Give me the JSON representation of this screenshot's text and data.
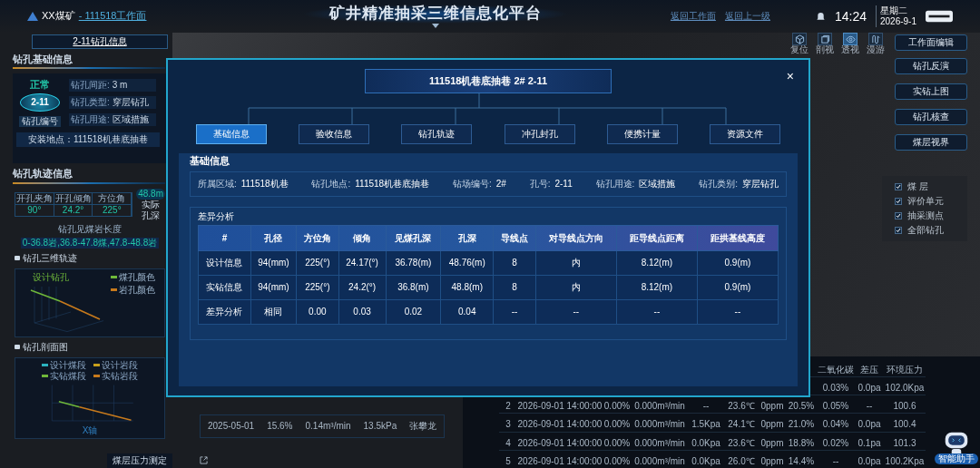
{
  "header": {
    "mine": "XX煤矿",
    "workface": "- 111518工作面",
    "title": "矿井精准抽采三维信息化平台",
    "nav": [
      "返回工作面",
      "返回上一级"
    ],
    "time": "14:24",
    "weekday": "星期二",
    "date": "2026-9-1"
  },
  "toolbar": [
    {
      "label": "复位",
      "selected": false
    },
    {
      "label": "剖视",
      "selected": false
    },
    {
      "label": "透视",
      "selected": true
    },
    {
      "label": "漫游",
      "selected": false
    }
  ],
  "left": {
    "tab": "2-11钻孔信息",
    "basic_title": "钻孔基础信息",
    "status": "正常",
    "hole_no": "2-11",
    "hole_no_label": "钻孔编号",
    "fields": [
      {
        "label": "钻孔间距:",
        "value": "3 m"
      },
      {
        "label": "钻孔类型:",
        "value": "穿层钻孔"
      },
      {
        "label": "钻孔用途:",
        "value": "区域措施"
      }
    ],
    "location": "安装地点：111518机巷底抽巷",
    "track_title": "钻孔轨迹信息",
    "angles": [
      {
        "label": "开孔夹角",
        "value": "90°"
      },
      {
        "label": "开孔倾角",
        "value": "24.2°"
      },
      {
        "label": "方位角",
        "value": "225°"
      }
    ],
    "depth": "48.8m",
    "depth_label": "实际孔深",
    "seam_label": "钻孔见煤岩长度",
    "seam_value": "0-36.8岩,36.8-47.8煤,47.8-48.8岩",
    "chart3d_title": "钻孔三维轨迹",
    "chart3d_legend": [
      {
        "label": "煤孔颜色",
        "color": "#6fb83a"
      },
      {
        "label": "岩孔颜色",
        "color": "#c87a1c"
      }
    ],
    "chart3d_note": "设计钻孔",
    "profile_title": "钻孔剖面图",
    "profile_legend": [
      {
        "label": "设计煤段",
        "color": "#2bb3c0"
      },
      {
        "label": "设计岩段",
        "color": "#c8a01c"
      },
      {
        "label": "实钻煤段",
        "color": "#6fb83a"
      },
      {
        "label": "实钻岩段",
        "color": "#c87a1c"
      }
    ],
    "profile_xlabel": "X轴",
    "bottom_label": "煤层压力测定"
  },
  "right_buttons": [
    "工作面编辑",
    "钻孔反演",
    "实钻上图",
    "钻孔核查",
    "煤层视界"
  ],
  "layers": [
    {
      "label": "煤 层",
      "checked": true
    },
    {
      "label": "评价单元",
      "checked": true
    },
    {
      "label": "抽采测点",
      "checked": true
    },
    {
      "label": "全部钻孔",
      "checked": true
    }
  ],
  "pressure_row": [
    "2025-05-01",
    "15.6%",
    "0.14m³/min",
    "13.5kPa",
    "张攀龙"
  ],
  "monitor": {
    "columns": [
      "二氧化碳",
      "差压",
      "环境压力"
    ],
    "rows": [
      [
        "0.03%",
        "0.0pa",
        "102.0Kpa"
      ],
      [
        "2",
        "2026-09-01 14:00:00",
        "0.00%",
        "0.000m³/min",
        "--",
        "23.6℃",
        "0ppm",
        "20.5%",
        "0.05%",
        "--",
        "100.6"
      ],
      [
        "3",
        "2026-09-01 14:00:00",
        "0.00%",
        "0.000m³/min",
        "1.5Kpa",
        "24.1℃",
        "0ppm",
        "21.0%",
        "0.04%",
        "0.0pa",
        "100.4"
      ],
      [
        "4",
        "2026-09-01 14:00:00",
        "0.00%",
        "0.000m³/min",
        "0.0Kpa",
        "23.6℃",
        "0ppm",
        "18.8%",
        "0.02%",
        "0.1pa",
        "101.3"
      ],
      [
        "5",
        "2026-09-01 14:00:00",
        "0.00%",
        "0.000m³/min",
        "0.0Kpa",
        "26.0℃",
        "0ppm",
        "14.4%",
        "--",
        "0.0pa",
        "100.2Kpa"
      ]
    ]
  },
  "assistant": "智能助手",
  "modal": {
    "title": "111518机巷底抽巷 2# 2-11",
    "close": "×",
    "tabs": [
      {
        "label": "基础信息",
        "selected": true
      },
      {
        "label": "验收信息",
        "selected": false
      },
      {
        "label": "钻孔轨迹",
        "selected": false
      },
      {
        "label": "冲孔封孔",
        "selected": false
      },
      {
        "label": "便携计量",
        "selected": false
      },
      {
        "label": "资源文件",
        "selected": false
      }
    ],
    "section": "基础信息",
    "info": [
      {
        "label": "所属区域:",
        "value": "111518机巷"
      },
      {
        "label": "钻孔地点:",
        "value": "111518机巷底抽巷"
      },
      {
        "label": "钻场编号:",
        "value": "2#"
      },
      {
        "label": "孔号:",
        "value": "2-11"
      },
      {
        "label": "钻孔用途:",
        "value": "区域措施"
      },
      {
        "label": "钻孔类别:",
        "value": "穿层钻孔"
      }
    ],
    "diff_title": "差异分析",
    "columns": [
      "#",
      "孔径",
      "方位角",
      "倾角",
      "见煤孔深",
      "孔深",
      "导线点",
      "对导线点方向",
      "距导线点距离",
      "距拱基线高度"
    ],
    "rows": [
      [
        "设计信息",
        "94(mm)",
        "225(°)",
        "24.17(°)",
        "36.78(m)",
        "48.76(m)",
        "8",
        "内",
        "8.12(m)",
        "0.9(m)"
      ],
      [
        "实钻信息",
        "94(mm)",
        "225(°)",
        "24.2(°)",
        "36.8(m)",
        "48.8(m)",
        "8",
        "内",
        "8.12(m)",
        "0.9(m)"
      ],
      [
        "差异分析",
        "相同",
        "0.00",
        "0.03",
        "0.02",
        "0.04",
        "--",
        "--",
        "--",
        "--"
      ]
    ]
  }
}
